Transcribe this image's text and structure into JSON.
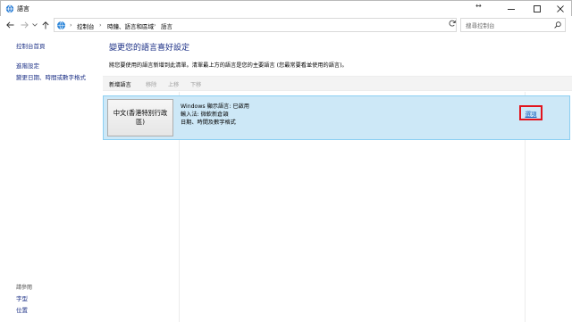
{
  "window": {
    "title": "語言",
    "resize_glyph": "↔"
  },
  "nav": {
    "breadcrumb": [
      "控制台",
      "時鐘、語言和區域",
      "語言"
    ],
    "breadcrumb_separator": "›",
    "search_placeholder": "搜尋控制台"
  },
  "sidebar": {
    "items": [
      {
        "label": "控制台首頁"
      },
      {
        "label": "進階設定"
      },
      {
        "label": "變更日期、時間或數字格式"
      }
    ],
    "see_also_title": "請參閱",
    "see_also": [
      {
        "label": "字型"
      },
      {
        "label": "位置"
      }
    ]
  },
  "main": {
    "title": "變更您的語言喜好設定",
    "description": "將您要使用的語言新增到此清單。清單最上方的語言是您的主要語言 (您最常要看並使用的語言)。",
    "toolbar": {
      "add": "新增語言",
      "remove": "移除",
      "up": "上移",
      "down": "下移"
    },
    "languages": [
      {
        "name": "中文(香港特別行政區)",
        "display": "Windows 顯示語言: 已啟用",
        "input": "輸入法: 微軟新倉頡",
        "format": "日期、時間及數字格式",
        "options_label": "選項"
      }
    ]
  },
  "colors": {
    "link": "#1e3287",
    "selection_bg": "#cde8f7",
    "selection_border": "#8ccff2",
    "highlight_box": "#e2141d"
  }
}
